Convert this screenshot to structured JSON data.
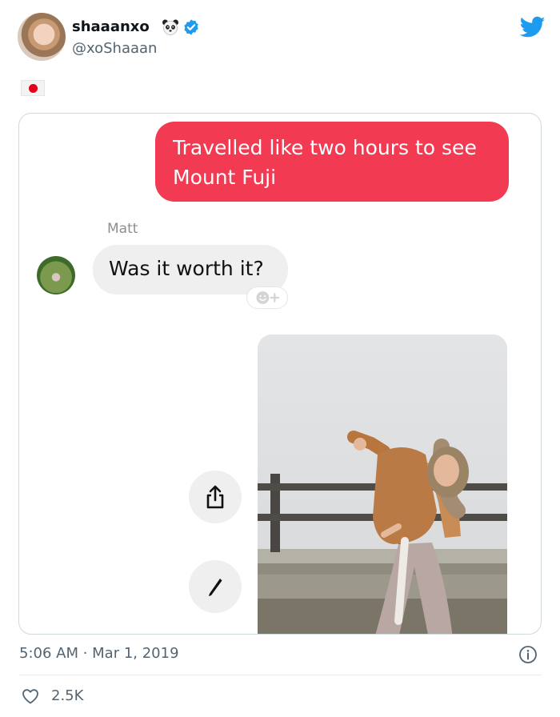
{
  "tweet": {
    "display_name": "shaaanxo",
    "handle": "@xoShaaan",
    "timestamp": "5:06 AM · Mar 1, 2019",
    "like_count": "2.5K"
  },
  "chat": {
    "sent_message": "Travelled like two hours to see Mount Fuji",
    "sender_name": "Matt",
    "received_message": "Was it worth it?"
  },
  "colors": {
    "twitter_blue": "#1d9bf0",
    "sent_bubble": "#f23a52",
    "received_bubble": "#efefef"
  },
  "icons": {
    "name_emoji": "panda-face-icon",
    "verified": "verified-badge-icon",
    "logo": "twitter-bird-icon",
    "flag": "japan-flag-icon",
    "reaction": "add-reaction-icon",
    "share": "share-icon",
    "draw": "pen-icon",
    "info": "info-icon",
    "like": "heart-icon"
  }
}
